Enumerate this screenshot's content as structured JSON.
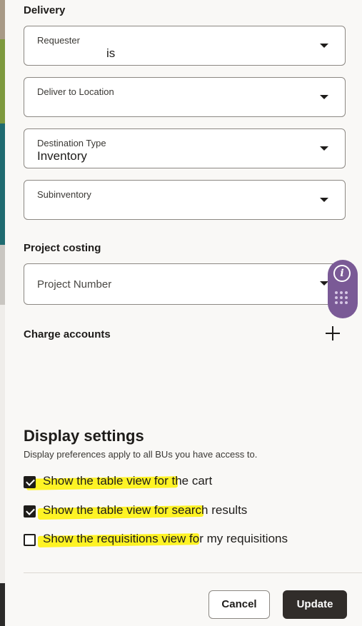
{
  "delivery": {
    "title": "Delivery",
    "fields": [
      {
        "label": "Requester",
        "value": "is"
      },
      {
        "label": "Deliver to Location",
        "value": ""
      },
      {
        "label": "Destination Type",
        "value": "Inventory"
      },
      {
        "label": "Subinventory",
        "value": ""
      }
    ]
  },
  "project_costing": {
    "title": "Project costing",
    "project_number_placeholder": "Project Number"
  },
  "charge_accounts": {
    "title": "Charge accounts"
  },
  "float_widget": {
    "info_glyph": "i"
  },
  "display_settings": {
    "title": "Display settings",
    "subtitle": "Display preferences apply to all BUs you have access to.",
    "options": [
      {
        "label": "Show the table view for the cart",
        "checked": true
      },
      {
        "label": "Show the table view for search results",
        "checked": true
      },
      {
        "label": "Show the requisitions view for my requisitions",
        "checked": false
      }
    ]
  },
  "footer": {
    "cancel_label": "Cancel",
    "update_label": "Update"
  },
  "colors": {
    "highlight": "#fff200",
    "primary_button": "#312d2a",
    "widget": "#7a5a96"
  }
}
